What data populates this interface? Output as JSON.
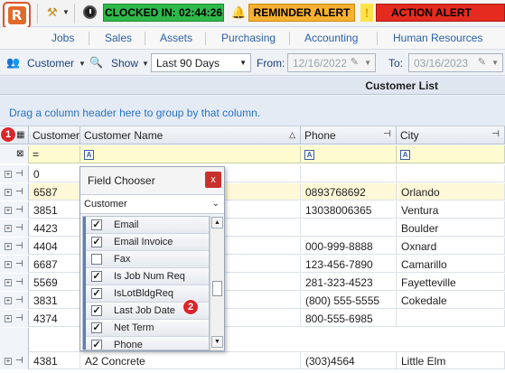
{
  "topbar": {
    "logo_letter": "R",
    "clocked_in": "CLOCKED IN: 02:44:26",
    "reminder_alert": "REMINDER ALERT",
    "action_alert": "ACTION ALERT",
    "warning_symbol": "!",
    "colors": {
      "clocked": "#2fb84a",
      "reminder": "#f7b02f",
      "action": "#e52b1f"
    }
  },
  "menu": {
    "items": [
      "Jobs",
      "Sales",
      "Assets",
      "Purchasing",
      "Accounting",
      "Human Resources"
    ]
  },
  "toolbar": {
    "customer_label": "Customer",
    "show_label": "Show",
    "period_value": "Last 90 Days",
    "from_label": "From:",
    "from_value": "12/16/2022",
    "to_label": "To:",
    "to_value": "03/16/2023"
  },
  "list": {
    "title": "Customer List",
    "group_hint": "Drag a column header here to group by that column.",
    "columns": [
      "Customer",
      "Customer Name",
      "Phone",
      "City"
    ],
    "filter_operator": "=",
    "filter_icon": "A",
    "rows": [
      {
        "customer": "0",
        "name": "",
        "phone": "",
        "city": ""
      },
      {
        "customer": "6587",
        "name": "",
        "phone": "0893768692",
        "city": "Orlando"
      },
      {
        "customer": "3851",
        "name": "",
        "phone": "13038006365",
        "city": "Ventura"
      },
      {
        "customer": "4423",
        "name": "",
        "phone": "",
        "city": "Boulder"
      },
      {
        "customer": "4404",
        "name": "",
        "phone": "000-999-8888",
        "city": "Oxnard"
      },
      {
        "customer": "6687",
        "name": "",
        "phone": "123-456-7890",
        "city": "Camarillo"
      },
      {
        "customer": "5569",
        "name": "",
        "phone": "281-323-4523",
        "city": "Fayetteville"
      },
      {
        "customer": "3831",
        "name": "",
        "phone": "(800) 555-5555",
        "city": "Cokedale"
      },
      {
        "customer": "4374",
        "name": "",
        "phone": "800-555-6985",
        "city": ""
      },
      {
        "customer": "4381",
        "name": "A2 Concrete",
        "phone": "(303)4564",
        "city": "Little Elm"
      }
    ]
  },
  "field_chooser": {
    "title": "Field Chooser",
    "close_label": "x",
    "selected_category": "Customer",
    "fields": [
      {
        "label": "Email",
        "checked": "✓"
      },
      {
        "label": "Email Invoice",
        "checked": "✓"
      },
      {
        "label": "Fax",
        "checked": ""
      },
      {
        "label": "Is Job Num Req",
        "checked": "✓"
      },
      {
        "label": "IsLotBldgReq",
        "checked": "✓"
      },
      {
        "label": "Last Job Date",
        "checked": "✓"
      },
      {
        "label": "Net Term",
        "checked": "✓"
      },
      {
        "label": "Phone",
        "checked": "✓"
      }
    ]
  },
  "badges": {
    "one": "1",
    "two": "2"
  }
}
